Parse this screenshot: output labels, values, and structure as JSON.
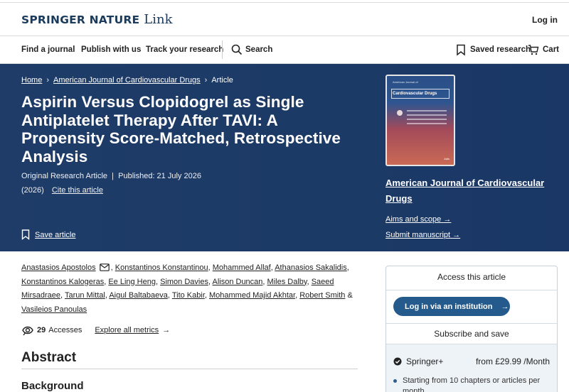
{
  "header": {
    "brand": "SPRINGER NATURE",
    "brand_sub": "Link",
    "login": "Log in"
  },
  "nav": {
    "find_journal": "Find a journal",
    "publish": "Publish with us",
    "track": "Track your research",
    "search": "Search",
    "saved": "Saved research",
    "cart": "Cart"
  },
  "breadcrumb": {
    "home": "Home",
    "journal": "American Journal of Cardiovascular Drugs",
    "current": "Article"
  },
  "article": {
    "title": "Aspirin Versus Clopidogrel as Single Antiplatelet Therapy After TAVI: A Propensity Score-Matched, Retrospective Analysis",
    "type_published": "Original Research Article  |  Published: 21 July 2026",
    "year": "(2026)",
    "cite": "Cite this article",
    "save": "Save article"
  },
  "journal_panel": {
    "cover_small": "American Journal of",
    "cover_title": "Cardiovascular Drugs",
    "cover_pub": "Adis",
    "title": "American Journal of Cardiovascular Drugs",
    "aims": "Aims and scope",
    "submit": "Submit manuscript"
  },
  "authors": [
    "Anastasios Apostolos",
    "Konstantinos Konstantinou",
    "Mohammed Allaf",
    "Athanasios Sakalidis",
    "Konstantinos Kalogeras",
    "Ee Ling Heng",
    "Simon Davies",
    "Alison Duncan",
    "Miles Dalby",
    "Saeed Mirsadraee",
    "Tarun Mittal",
    "Aigul Baltabaeva",
    "Tito Kabir",
    "Mohammed Majid Akhtar",
    "Robert Smith",
    "Vasileios Panoulas"
  ],
  "author_sep": {
    "comma": ",",
    "amp": "&"
  },
  "metrics": {
    "accesses": "29",
    "accesses_label": "Accesses",
    "explore": "Explore all metrics"
  },
  "abstract": {
    "heading": "Abstract",
    "background": "Background"
  },
  "access_box": {
    "title": "Access this article",
    "institution_button": "Log in via an institution",
    "subscribe": "Subscribe and save",
    "plan": "Springer+",
    "price": "from £29.99 /Month",
    "bullet": "Starting from 10 chapters or articles per month"
  },
  "colors": {
    "hero": "#1f3c68",
    "brand": "#1a3b5c",
    "button": "#245a8c"
  }
}
